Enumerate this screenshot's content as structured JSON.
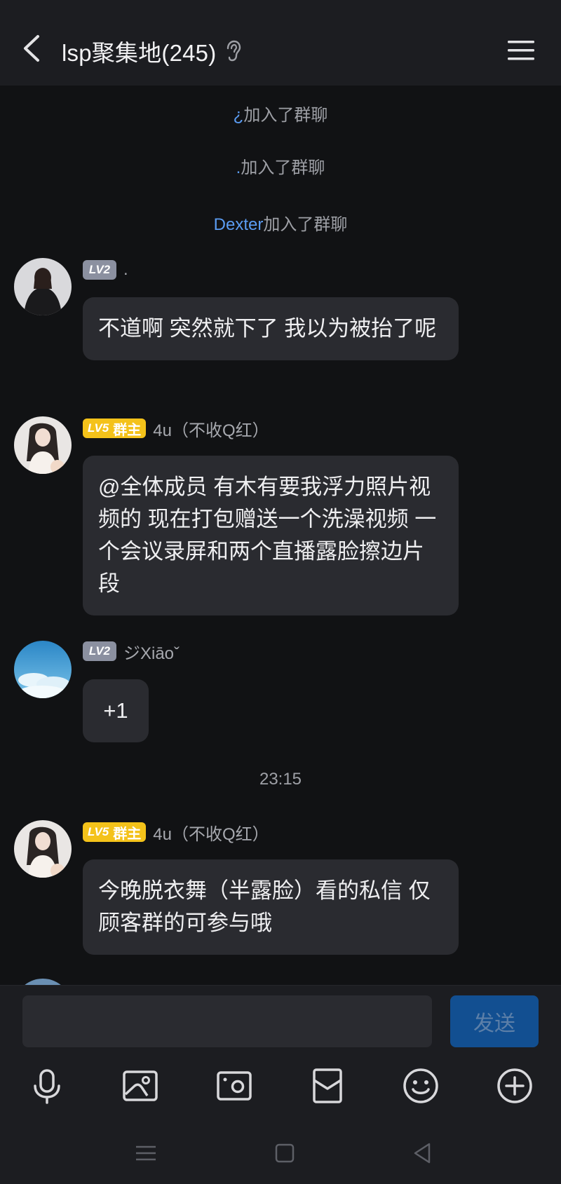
{
  "header": {
    "title": "lsp聚集地(245)",
    "back_icon": "chevron-left-icon",
    "mode_icon": "ear-icon",
    "menu_icon": "hamburger-menu-icon"
  },
  "system_messages": [
    {
      "name": "¿",
      "text": "加入了群聊"
    },
    {
      "name": ".",
      "text": "加入了群聊"
    },
    {
      "name": "Dexter",
      "text": "加入了群聊"
    }
  ],
  "messages": [
    {
      "level": "LV2",
      "role": "",
      "nickname": ".",
      "text": "不道啊 突然就下了 我以为被抬了呢"
    },
    {
      "level": "LV5",
      "role": "群主",
      "nickname": "4u（不收Q红）",
      "text": "@全体成员 有木有要我浮力照片视频的 现在打包赠送一个洗澡视频 一个会议录屏和两个直播露脸擦边片段"
    },
    {
      "level": "LV2",
      "role": "",
      "nickname": "ジXiāoˇ",
      "text": "+1"
    },
    {
      "level": "LV5",
      "role": "群主",
      "nickname": "4u（不收Q红）",
      "text": "今晚脱衣舞（半露脸）看的私信 仅顾客群的可参与哦"
    }
  ],
  "timestamp": "23:15",
  "composer": {
    "input_value": "",
    "send_label": "发送"
  },
  "toolbar": [
    "microphone-icon",
    "image-icon",
    "camera-icon",
    "red-packet-icon",
    "emoji-icon",
    "plus-icon"
  ],
  "nav": [
    "recent-apps-icon",
    "home-icon",
    "back-icon"
  ],
  "colors": {
    "background": "#111214",
    "header": "#1c1d21",
    "bubble": "#2a2b30",
    "link": "#5b9cf2",
    "lv2_badge": "#8b90a0",
    "lv5_badge": "#f4c21a",
    "send_button": "#124f91"
  }
}
